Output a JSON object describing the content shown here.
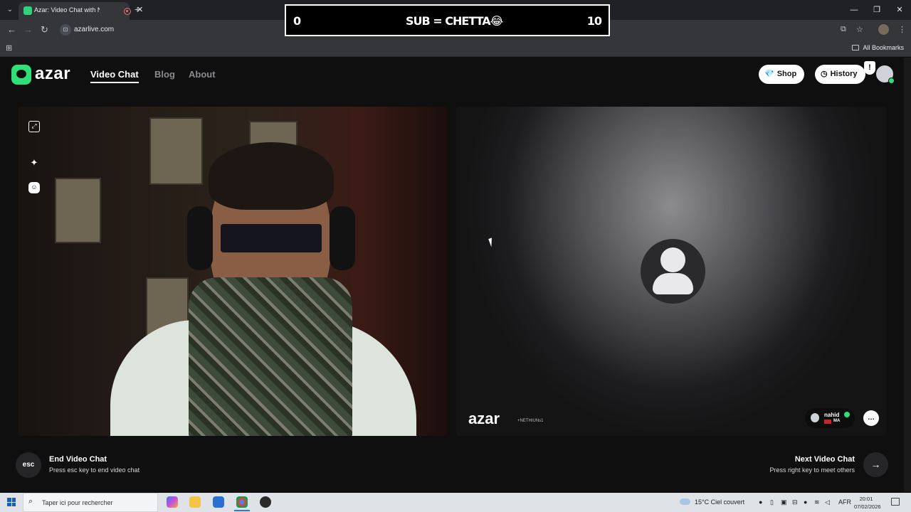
{
  "browser": {
    "tab_title": "Azar: Video Chat with New",
    "tab_close": "✕",
    "new_tab": "+",
    "window_buttons": [
      "—",
      "❐",
      "✕"
    ],
    "url": "azarlive.com",
    "bookmarks_label": "All Bookmarks"
  },
  "banner": {
    "left_value": "0",
    "center_text": "SUB = CHETTA😂",
    "right_value": "10"
  },
  "header": {
    "brand": "azar",
    "nav": [
      "Video Chat",
      "Blog",
      "About"
    ],
    "active_nav": "Video Chat",
    "shop_label": "Shop",
    "history_label": "History"
  },
  "remote": {
    "watermark": "azar",
    "watermark_tag": "+NETHIUNs1",
    "peer_name": "nahid",
    "peer_country": "MA"
  },
  "bottom": {
    "esc_key": "esc",
    "end_title": "End Video Chat",
    "end_sub": "Press esc key to end video chat",
    "next_title": "Next Video Chat",
    "next_sub": "Press right key to meet others",
    "next_arrow": "→"
  },
  "taskbar": {
    "search_placeholder": "Taper ici pour rechercher",
    "weather": "15°C  Ciel couvert",
    "lang": "AFR",
    "time": "20:01",
    "date": "07/02/2026"
  },
  "colors": {
    "brand_green": "#2fe07a",
    "page_bg": "#0f0f10"
  }
}
